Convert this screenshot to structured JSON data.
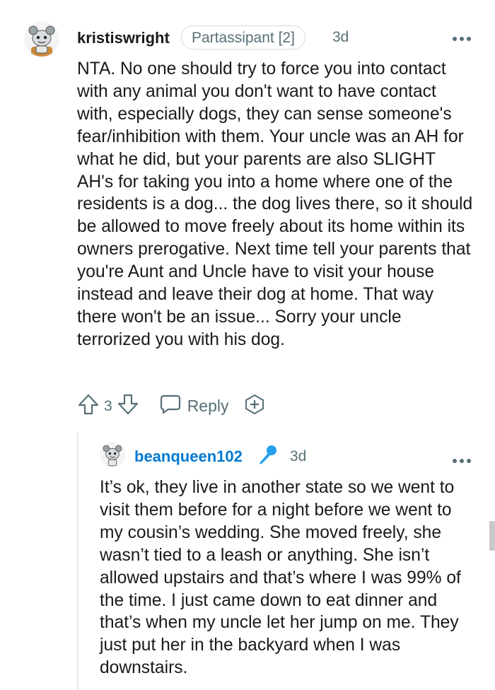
{
  "comment": {
    "username": "kristiswright",
    "flair": "Partassipant [2]",
    "time": "3d",
    "more": "•••",
    "text": "NTA. No one should try to force you into contact with any animal you don't want to have contact with, especially dogs, they can sense someone's fear/inhibition with them. Your uncle was an AH for what he did, but your parents are also SLIGHT AH's for taking you into a home where one of the residents is a dog... the dog lives there, so it should be allowed to move freely about its home within its owners prerogative. Next time tell your parents that you're Aunt and Uncle have to visit your house instead and leave their dog at home. That way there won't be an issue... Sorry your uncle terrorized you with his dog.",
    "votes": "3",
    "reply_label": "Reply"
  },
  "reply": {
    "username": "beanqueen102",
    "time": "3d",
    "more": "•••",
    "text": "It’s ok, they live in another state so we went to visit them before for a night before we went to my cousin’s wedding. She moved freely, she wasn’t tied to a leash or anything. She isn’t allowed upstairs and that’s where I was 99% of the time. I just came down to eat dinner and that’s when my uncle let her jump on me. They just put her in the backyard when I was downstairs."
  },
  "icons": {
    "upvote": "arrow-up-icon",
    "downvote": "arrow-down-icon",
    "reply": "speech-bubble-icon",
    "award": "plus-award-icon",
    "mic": "microphone-icon"
  },
  "colors": {
    "text": "#1a1a1b",
    "meta": "#576f76",
    "link_blue": "#0079d3",
    "mic_blue": "#24a0ed"
  }
}
